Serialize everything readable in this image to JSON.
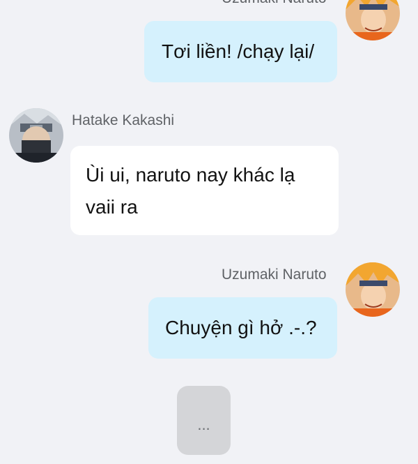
{
  "messages": [
    {
      "sender": "Uzumaki Naruto",
      "text": "Tơi liền! /chạy lại/"
    },
    {
      "sender": "Hatake Kakashi",
      "text": "Ùi ui, naruto nay khác lạ vaii ra"
    },
    {
      "sender": "Uzumaki Naruto",
      "text": "Chuyện gì hở .-.?"
    }
  ],
  "typing": {
    "text": "..."
  },
  "colors": {
    "background": "#f1f2f6",
    "outgoing_bubble": "#d5f1fd",
    "incoming_bubble": "#ffffff",
    "typing_bubble": "#d4d5d8"
  }
}
